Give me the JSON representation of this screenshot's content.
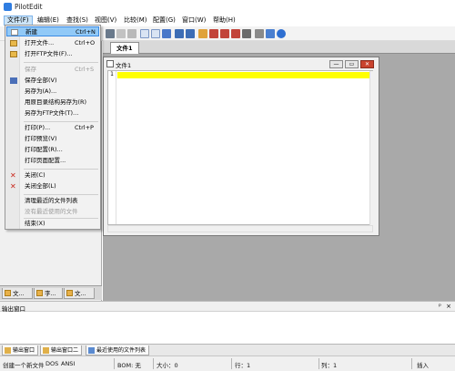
{
  "app": {
    "title": "PilotEdit"
  },
  "menubar": [
    {
      "label": "文件(F)",
      "active": true
    },
    {
      "label": "编辑(E)"
    },
    {
      "label": "查找(S)"
    },
    {
      "label": "视图(V)"
    },
    {
      "label": "比较(M)"
    },
    {
      "label": "配置(G)"
    },
    {
      "label": "窗口(W)"
    },
    {
      "label": "帮助(H)"
    }
  ],
  "file_menu": [
    {
      "label": "新建",
      "shortcut": "Ctrl+N",
      "icon": "new-file-icon",
      "highlighted": true
    },
    {
      "label": "打开文件...",
      "shortcut": "Ctrl+O",
      "icon": "folder-open-icon"
    },
    {
      "label": "打开FTP文件(F)...",
      "shortcut": "",
      "icon": "ftp-folder-icon"
    },
    {
      "label": "保存",
      "shortcut": "Ctrl+S",
      "disabled": true
    },
    {
      "label": "保存全部(V)",
      "shortcut": "",
      "icon": "save-all-icon"
    },
    {
      "label": "另存为(A)...",
      "shortcut": ""
    },
    {
      "label": "用原目录结构另存为(R)",
      "shortcut": ""
    },
    {
      "label": "另存为FTP文件(T)...",
      "shortcut": ""
    },
    {
      "label": "打印(P)...",
      "shortcut": "Ctrl+P"
    },
    {
      "label": "打印预览(V)",
      "shortcut": ""
    },
    {
      "label": "打印配置(R)...",
      "shortcut": ""
    },
    {
      "label": "打印页面配置...",
      "shortcut": ""
    },
    {
      "label": "关闭(C)",
      "shortcut": "",
      "icon": "close-icon"
    },
    {
      "label": "关闭全部(L)",
      "shortcut": "",
      "icon": "close-all-icon"
    },
    {
      "label": "清理最近的文件列表",
      "shortcut": ""
    },
    {
      "label": "没有最近使用的文件",
      "shortcut": "",
      "disabled": true
    },
    {
      "label": "结束(X)",
      "shortcut": ""
    }
  ],
  "left_tabs": [
    {
      "label": "文..."
    },
    {
      "label": "字..."
    },
    {
      "label": "文..."
    }
  ],
  "doc_tab": {
    "label": "文件1"
  },
  "doc_window": {
    "title": "文件1",
    "line_number": "1"
  },
  "window_buttons": {
    "minimize": "—",
    "restore": "▭",
    "close": "✕"
  },
  "output": {
    "title": "输出窗口",
    "pin": "ᵖ",
    "close": "×",
    "tabs": [
      {
        "label": "输出窗口"
      },
      {
        "label": "输出窗口二"
      },
      {
        "label": "最近使用的文件列表"
      }
    ]
  },
  "statusbar": {
    "message": "创建一个新文件",
    "format": "DOS",
    "encoding": "ANSI",
    "bom": "BOM: 无",
    "size": "大小：0",
    "line": "行：1",
    "col": "列：1",
    "mode": "插入"
  },
  "colors": {
    "highlight_line": "#ffff00",
    "menu_hover": "#91c9f7",
    "close_button": "#c9432e"
  }
}
